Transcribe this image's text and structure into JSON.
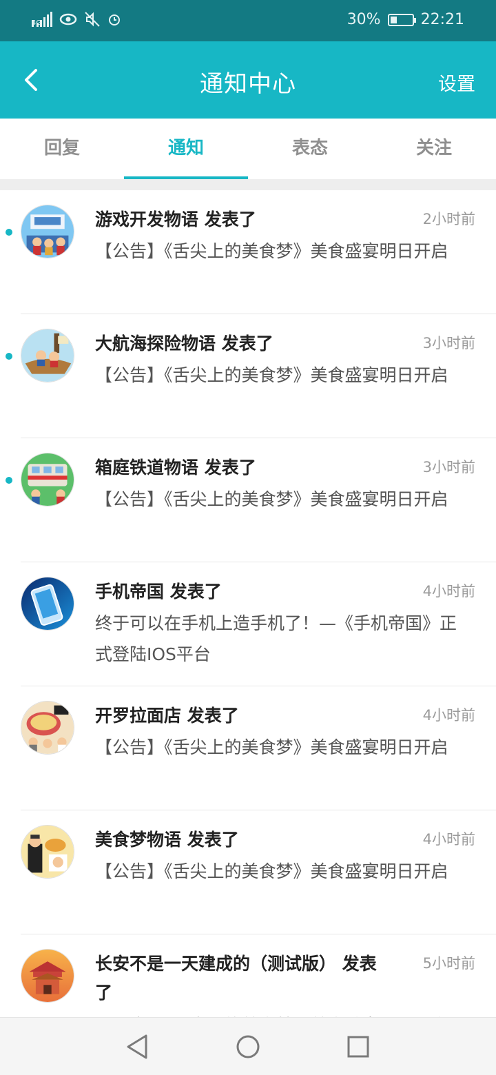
{
  "status_bar": {
    "network": "4G",
    "battery": "30%",
    "battery_level": 0.3,
    "time": "22:21",
    "icons": [
      "signal-icon",
      "eye-icon",
      "mute-icon",
      "alarm-icon",
      "battery-icon"
    ]
  },
  "header": {
    "title": "通知中心",
    "settings_label": "设置"
  },
  "tabs": [
    {
      "label": "回复",
      "active": false
    },
    {
      "label": "通知",
      "active": true
    },
    {
      "label": "表态",
      "active": false
    },
    {
      "label": "关注",
      "active": false
    }
  ],
  "notifications": [
    {
      "title": "游戏开发物语 发表了",
      "time": "2小时前",
      "body": "【公告】《舌尖上的美食梦》美食盛宴明日开启",
      "unread": true
    },
    {
      "title": "大航海探险物语 发表了",
      "time": "3小时前",
      "body": "【公告】《舌尖上的美食梦》美食盛宴明日开启",
      "unread": true
    },
    {
      "title": "箱庭铁道物语 发表了",
      "time": "3小时前",
      "body": "【公告】《舌尖上的美食梦》美食盛宴明日开启",
      "unread": true
    },
    {
      "title": "手机帝国 发表了",
      "time": "4小时前",
      "body": "终于可以在手机上造手机了！—《手机帝国》正式登陆IOS平台",
      "unread": false
    },
    {
      "title": "开罗拉面店 发表了",
      "time": "4小时前",
      "body": "【公告】《舌尖上的美食梦》美食盛宴明日开启",
      "unread": false
    },
    {
      "title": "美食梦物语 发表了",
      "time": "4小时前",
      "body": "【公告】《舌尖上的美食梦》美食盛宴明日开启",
      "unread": false
    },
    {
      "title": "长安不是一天建成的（测试版） 发表了",
      "time": "5小时前",
      "body": "【公告】《舌尖上的美食梦》美食盛宴明日开启",
      "unread": false
    }
  ],
  "colors": {
    "accent": "#17b7c5",
    "status_bar": "#137a83",
    "unread_dot": "#17b7c5"
  },
  "nav_bar": {
    "icons": [
      "back-triangle-icon",
      "home-circle-icon",
      "recents-square-icon"
    ]
  }
}
